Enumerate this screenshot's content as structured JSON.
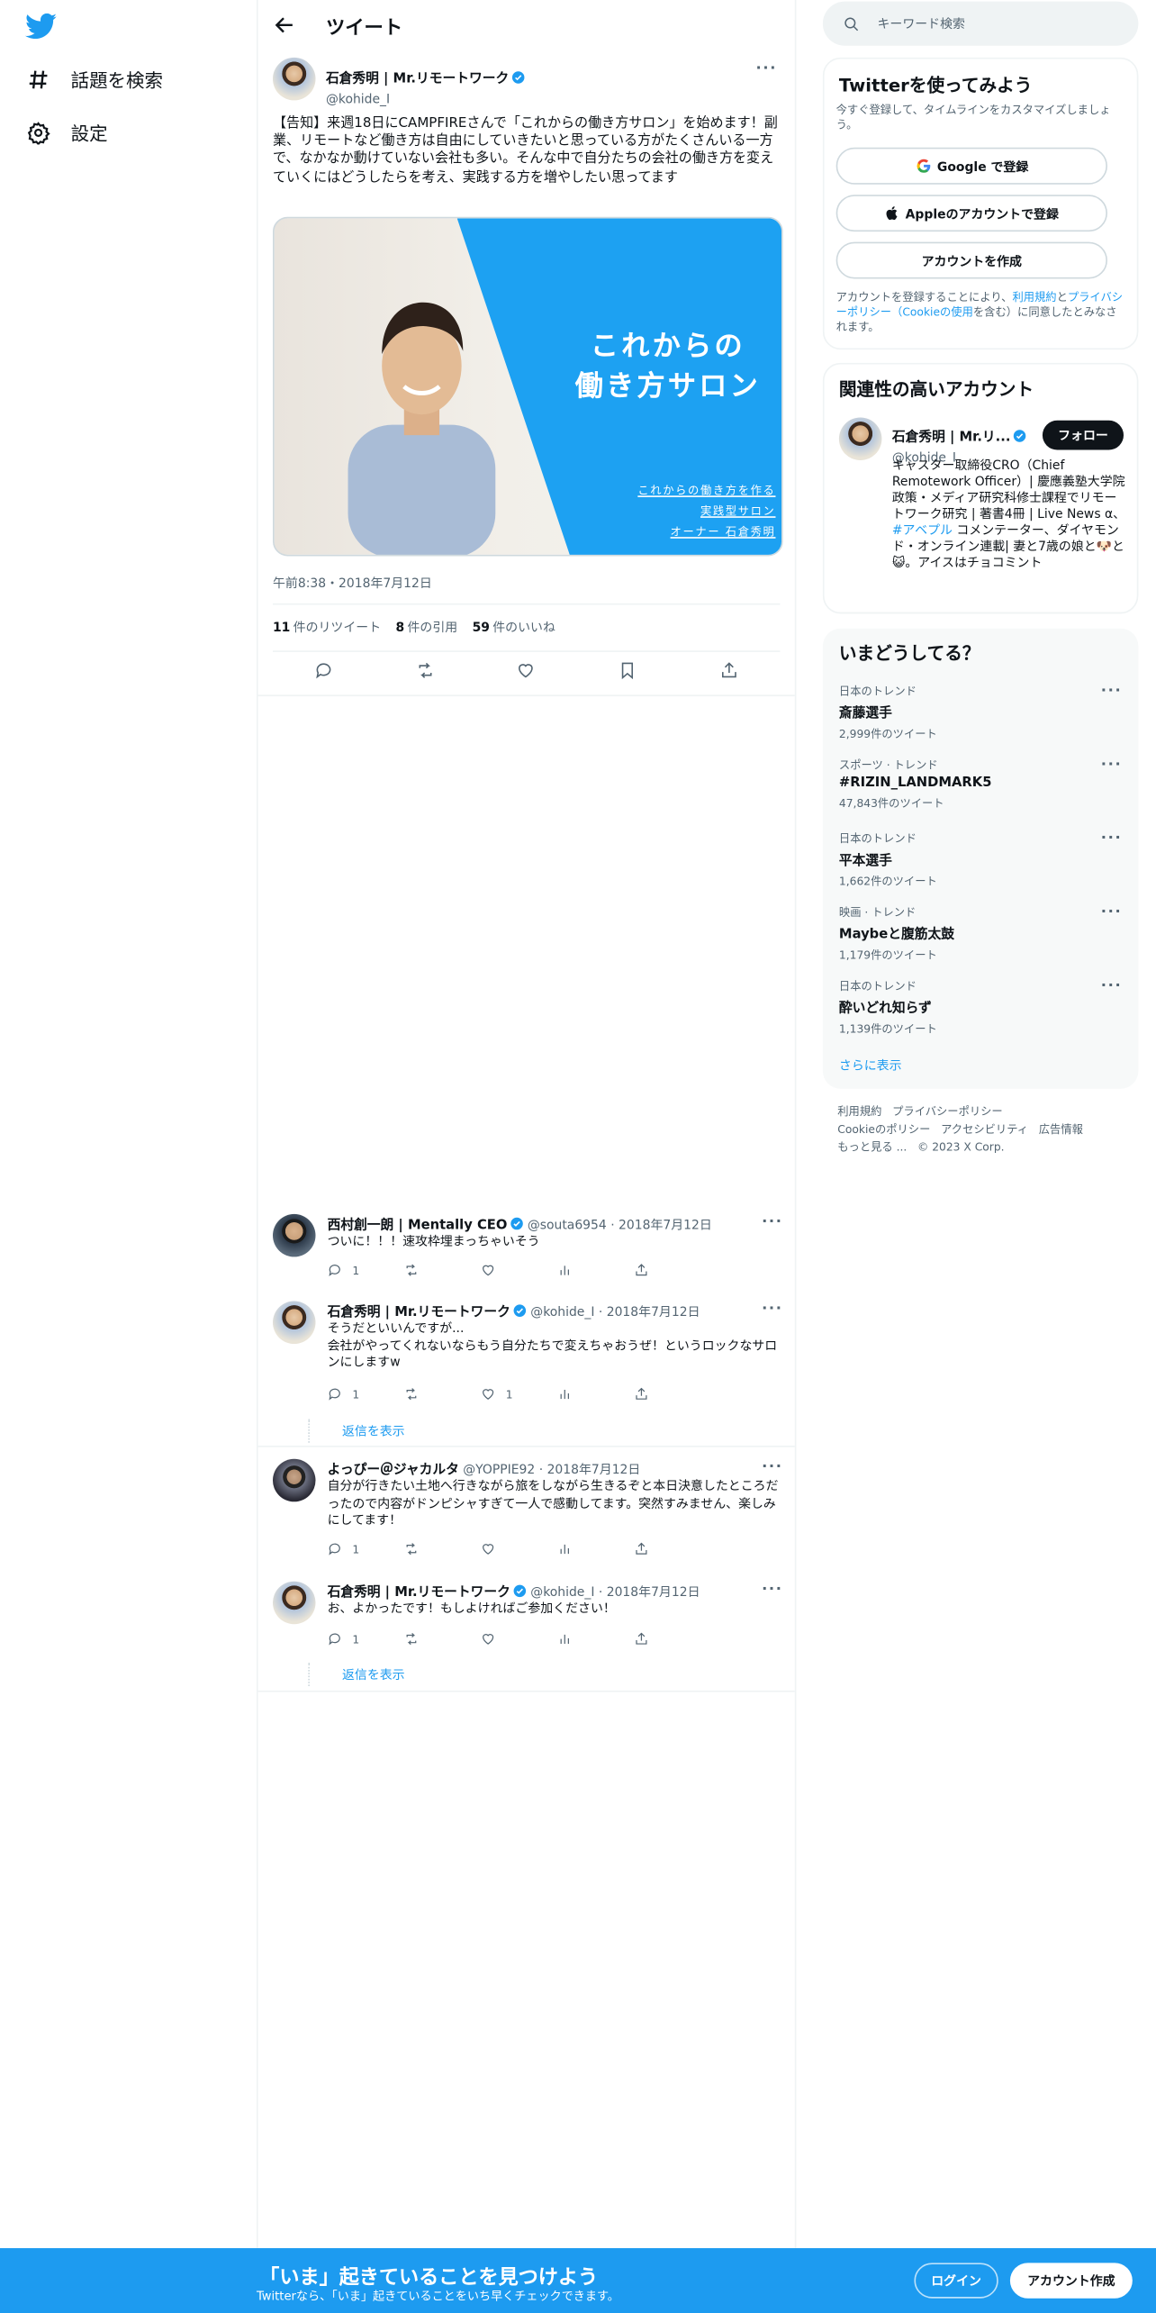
{
  "sidebar": {
    "items": [
      {
        "label": "話題を検索",
        "icon": "hashtag-icon"
      },
      {
        "label": "設定",
        "icon": "gear-icon"
      }
    ]
  },
  "header": {
    "title": "ツイート"
  },
  "main_tweet": {
    "name": "石倉秀明 | Mr.リモートワーク",
    "handle": "@kohide_I",
    "text": "【告知】来週18日にCAMPFIREさんで「これからの働き方サロン」を始めます！副業、リモートなど働き方は自由にしていきたいと思っている方がたくさんいる一方で、なかなか動けていない会社も多い。そんな中で自分たちの会社の働き方を変えていくにはどうしたらを考え、実践する方を増やしたい思ってます",
    "image": {
      "headline_1": "これからの",
      "headline_2": "働き方サロン",
      "sub_1": "これからの働き方を作る",
      "sub_2": "実践型サロン",
      "sub_3": "オーナー 石倉秀明"
    },
    "timestamp": "午前8:38・2018年7月12日",
    "stats": [
      {
        "count": "11",
        "label": "件のリツイート"
      },
      {
        "count": "8",
        "label": "件の引用"
      },
      {
        "count": "59",
        "label": "件のいいね"
      }
    ]
  },
  "replies": [
    {
      "name": "西村創一朗 | Mentally CEO",
      "handle": "@souta6954",
      "date": "· 2018年7月12日",
      "text": "ついに！！！速攻枠埋まっちゃいそう",
      "reply_count": "1",
      "like_count": ""
    },
    {
      "name": "石倉秀明 | Mr.リモートワーク",
      "handle": "@kohide_I",
      "date": "· 2018年7月12日",
      "text": "そうだといいんですが...\n会社がやってくれないならもう自分たちで変えちゃおうぜ！というロックなサロンにしますw",
      "reply_count": "1",
      "like_count": "1",
      "show_replies": "返信を表示"
    },
    {
      "name": "よっぴー＠ジャカルタ",
      "handle": "@YOPPIE92",
      "date": "· 2018年7月12日",
      "text": "自分が行きたい土地へ行きながら旅をしながら生きるぞと本日決意したところだったので内容がドンピシャすぎて一人で感動してます。突然すみません、楽しみにしてます！",
      "reply_count": "1",
      "like_count": ""
    },
    {
      "name": "石倉秀明 | Mr.リモートワーク",
      "handle": "@kohide_I",
      "date": "· 2018年7月12日",
      "text": "お、よかったです！もしよければご参加ください！",
      "reply_count": "1",
      "like_count": "",
      "show_replies": "返信を表示"
    }
  ],
  "search": {
    "placeholder": "キーワード検索"
  },
  "signup_panel": {
    "title": "Twitterを使ってみよう",
    "subtitle": "今すぐ登録して、タイムラインをカスタマイズしましょう。",
    "google": "Google で登録",
    "apple": "Appleのアカウントで登録",
    "create": "アカウントを作成",
    "terms_1": "アカウントを登録することにより、",
    "terms_link_1": "利用規約",
    "terms_2": "と",
    "terms_link_2": "プライバシーポリシー（Cookieの使用",
    "terms_3": "を含む）に同意したとみなされます。"
  },
  "related_panel": {
    "title": "関連性の高いアカウント",
    "name": "石倉秀明 | Mr.リ...",
    "handle": "@kohide_I",
    "follow": "フォロー",
    "bio_1": "キャスター取締役CRO（Chief Remotework Officer）| 慶應義塾大学院政策・メディア研究科修士課程でリモートワーク研究 | 著書4冊 | Live News α、",
    "bio_link": "#アベプル",
    "bio_2": " コメンテーター、ダイヤモンド・オンライン連載| 妻と7歳の娘と🐶と😺。アイスはチョコミント"
  },
  "trends_panel": {
    "title": "いまどうしてる？",
    "items": [
      {
        "category": "日本のトレンド",
        "topic": "斎藤選手",
        "count": "2,999件のツイート"
      },
      {
        "category": "スポーツ · トレンド",
        "topic": "#RIZIN_LANDMARK5",
        "count": "47,843件のツイート"
      },
      {
        "category": "日本のトレンド",
        "topic": "平本選手",
        "count": "1,662件のツイート"
      },
      {
        "category": "映画 · トレンド",
        "topic": "Maybeと腹筋太鼓",
        "count": "1,179件のツイート"
      },
      {
        "category": "日本のトレンド",
        "topic": "酔いどれ知らず",
        "count": "1,139件のツイート"
      }
    ],
    "show_more": "さらに表示"
  },
  "footer": {
    "line1_a": "利用規約",
    "line1_b": "プライバシーポリシー",
    "line2_a": "Cookieのポリシー",
    "line2_b": "アクセシビリティ",
    "line2_c": "広告情報",
    "line3_a": "もっと見る ...",
    "line3_b": "© 2023 X Corp."
  },
  "bottom_bar": {
    "title": "「いま」起きていることを見つけよう",
    "subtitle": "Twitterなら、「いま」起きていることをいち早くチェックできます。",
    "login": "ログイン",
    "signup": "アカウント作成"
  },
  "colors": {
    "accent": "#1d9bf0",
    "text": "#0f1419",
    "muted": "#536471",
    "border": "#eff3f4"
  }
}
